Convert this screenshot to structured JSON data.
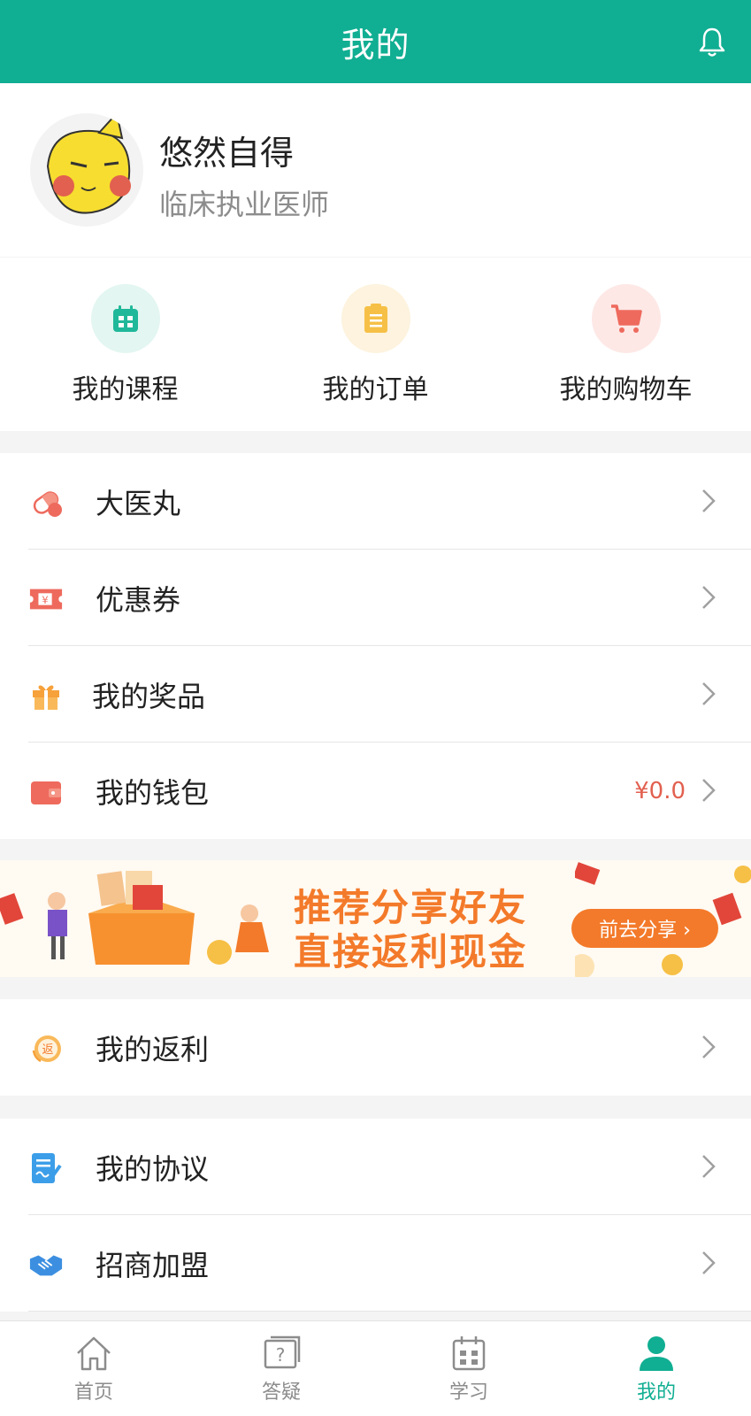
{
  "header": {
    "title": "我的"
  },
  "profile": {
    "name": "悠然自得",
    "role": "临床执业医师"
  },
  "quick_actions": [
    {
      "label": "我的课程",
      "icon": "calendar-icon",
      "color": "#20b89a",
      "bg": "#e3f6f1"
    },
    {
      "label": "我的订单",
      "icon": "clipboard-icon",
      "color": "#f6c046",
      "bg": "#fdf3de"
    },
    {
      "label": "我的购物车",
      "icon": "cart-icon",
      "color": "#ee6a5d",
      "bg": "#fde8e6"
    }
  ],
  "menu_group_1": [
    {
      "label": "大医丸",
      "icon": "pill-icon"
    },
    {
      "label": "优惠券",
      "icon": "coupon-icon"
    },
    {
      "label": "我的奖品",
      "icon": "gift-icon"
    },
    {
      "label": "我的钱包",
      "icon": "wallet-icon",
      "value": "¥0.0"
    }
  ],
  "banner": {
    "line1": "推荐分享好友",
    "line2": "直接返利现金",
    "button": "前去分享 ›"
  },
  "menu_group_2": [
    {
      "label": "我的返利",
      "icon": "rebate-icon"
    }
  ],
  "menu_group_3": [
    {
      "label": "我的协议",
      "icon": "agreement-icon"
    },
    {
      "label": "招商加盟",
      "icon": "handshake-icon"
    }
  ],
  "tabbar": [
    {
      "label": "首页",
      "icon": "home-icon"
    },
    {
      "label": "答疑",
      "icon": "question-icon"
    },
    {
      "label": "学习",
      "icon": "calendar-icon"
    },
    {
      "label": "我的",
      "icon": "person-icon",
      "active": true
    }
  ],
  "colors": {
    "primary": "#10ae92",
    "accent": "#f37a2a",
    "price": "#e2604f"
  }
}
